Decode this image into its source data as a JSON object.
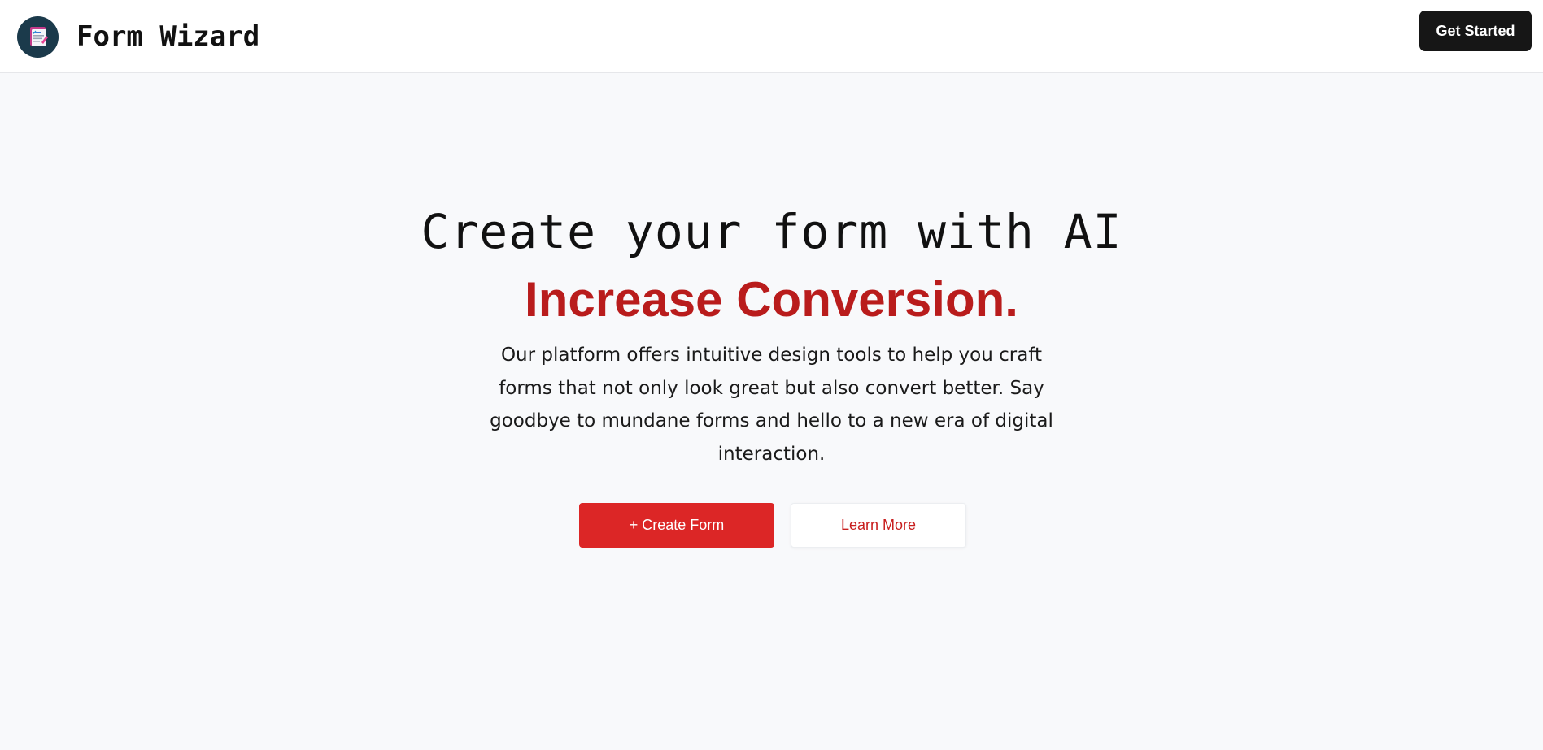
{
  "header": {
    "brand_name": "Form Wizard",
    "logo_icon": "form-edit-icon",
    "get_started_label": "Get Started"
  },
  "hero": {
    "title": "Create your form with AI",
    "accent": "Increase Conversion.",
    "description": "Our platform offers intuitive design tools to help you craft forms that not only look great but also convert better. Say goodbye to mundane forms and hello to a new era of digital interaction.",
    "primary_label": "+ Create Form",
    "secondary_label": "Learn More"
  },
  "colors": {
    "accent_red": "#b91c1c",
    "button_red": "#dc2626",
    "dark_button": "#161616",
    "logo_bg": "#1b3a4b"
  }
}
